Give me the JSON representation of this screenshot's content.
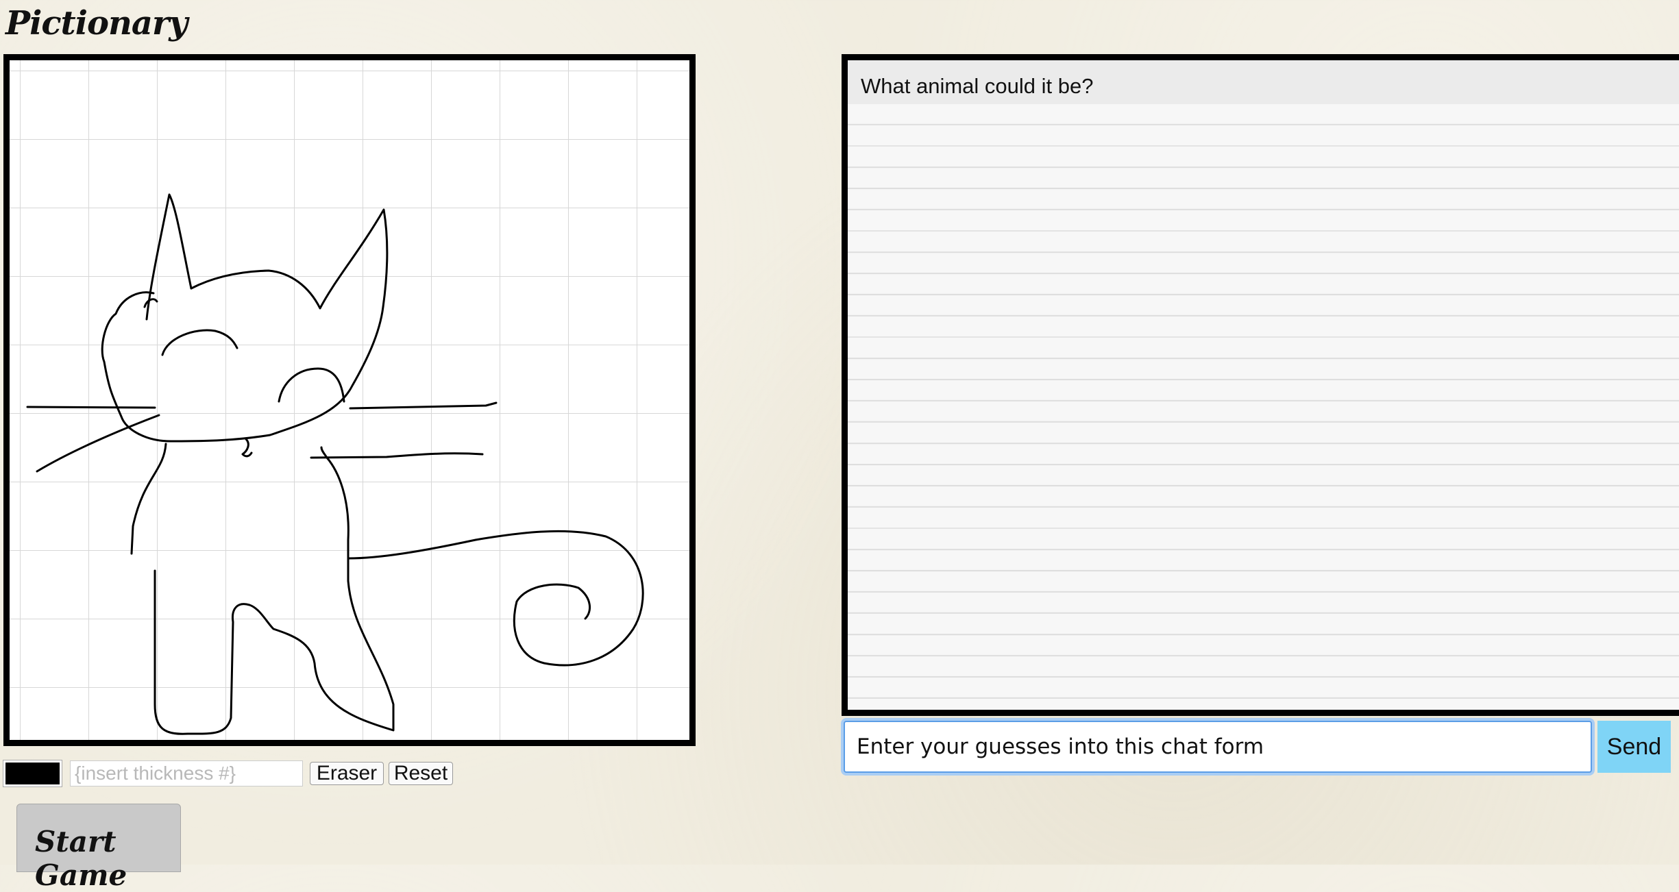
{
  "app": {
    "title": "Pictionary"
  },
  "drawing": {
    "subject": "cat",
    "pen_color": "#000000",
    "thickness_placeholder": "{insert thickness #}",
    "eraser_label": "Eraser",
    "reset_label": "Reset"
  },
  "game": {
    "start_label": "Start Game"
  },
  "chat": {
    "header": "What animal could it be?",
    "input_value": "Enter your guesses into this chat form",
    "send_label": "Send"
  },
  "colors": {
    "background": "#f1ede0",
    "frame": "#000000",
    "send_button": "#7fd4f6",
    "input_focus": "#5b9de6"
  }
}
